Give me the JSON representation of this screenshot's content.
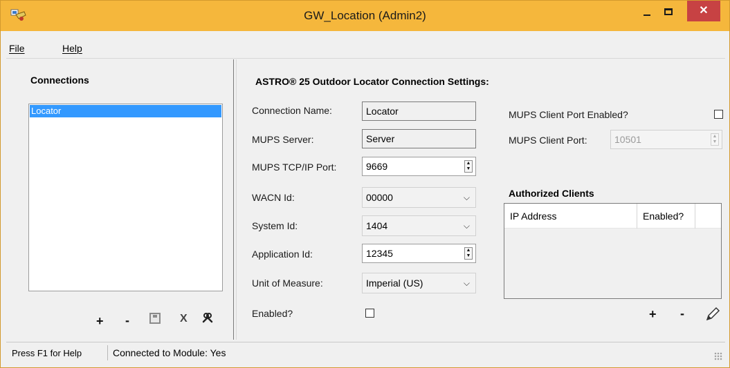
{
  "window": {
    "title": "GW_Location (Admin2)",
    "close_glyph": "✕",
    "colors": {
      "titlebar": "#f5b73c",
      "close_button": "#c74243",
      "selection": "#3399ff"
    }
  },
  "menu": {
    "file": "File",
    "help": "Help"
  },
  "connections": {
    "heading": "Connections",
    "items": [
      {
        "label": "Locator",
        "selected": true
      }
    ],
    "toolbar": {
      "add": "+",
      "remove": "-",
      "delete": "X",
      "save_icon": "floppy-disk-icon",
      "settings_icon": "tools-icon"
    }
  },
  "settings": {
    "heading": "ASTRO® 25 Outdoor Locator Connection Settings:",
    "connection_name": {
      "label": "Connection Name:",
      "value": "Locator"
    },
    "mups_server": {
      "label": "MUPS Server:",
      "value": "Server"
    },
    "mups_port": {
      "label": "MUPS TCP/IP Port:",
      "value": "9669"
    },
    "wacn_id": {
      "label": "WACN Id:",
      "value": "00000"
    },
    "system_id": {
      "label": "System Id:",
      "value": "1404"
    },
    "application_id": {
      "label": "Application Id:",
      "value": "12345"
    },
    "unit_of_measure": {
      "label": "Unit of Measure:",
      "value": "Imperial (US)"
    },
    "enabled": {
      "label": "Enabled?",
      "checked": false
    },
    "mups_client_port_enabled": {
      "label": "MUPS Client Port Enabled?",
      "checked": false
    },
    "mups_client_port": {
      "label": "MUPS Client Port:",
      "value": "10501"
    }
  },
  "authorized_clients": {
    "heading": "Authorized Clients",
    "columns": [
      "IP Address",
      "Enabled?"
    ],
    "rows": [],
    "toolbar": {
      "add": "+",
      "remove": "-",
      "edit_icon": "pencil-icon"
    }
  },
  "status": {
    "help": "Press F1 for Help",
    "connection": "Connected to Module: Yes"
  }
}
